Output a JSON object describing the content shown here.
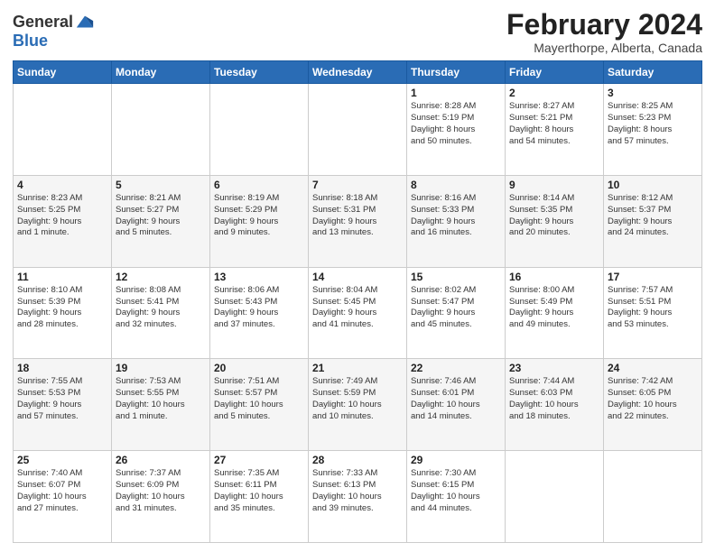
{
  "header": {
    "logo_line1": "General",
    "logo_line2": "Blue",
    "main_title": "February 2024",
    "subtitle": "Mayerthorpe, Alberta, Canada"
  },
  "calendar": {
    "headers": [
      "Sunday",
      "Monday",
      "Tuesday",
      "Wednesday",
      "Thursday",
      "Friday",
      "Saturday"
    ],
    "weeks": [
      [
        {
          "day": "",
          "info": ""
        },
        {
          "day": "",
          "info": ""
        },
        {
          "day": "",
          "info": ""
        },
        {
          "day": "",
          "info": ""
        },
        {
          "day": "1",
          "info": "Sunrise: 8:28 AM\nSunset: 5:19 PM\nDaylight: 8 hours\nand 50 minutes."
        },
        {
          "day": "2",
          "info": "Sunrise: 8:27 AM\nSunset: 5:21 PM\nDaylight: 8 hours\nand 54 minutes."
        },
        {
          "day": "3",
          "info": "Sunrise: 8:25 AM\nSunset: 5:23 PM\nDaylight: 8 hours\nand 57 minutes."
        }
      ],
      [
        {
          "day": "4",
          "info": "Sunrise: 8:23 AM\nSunset: 5:25 PM\nDaylight: 9 hours\nand 1 minute."
        },
        {
          "day": "5",
          "info": "Sunrise: 8:21 AM\nSunset: 5:27 PM\nDaylight: 9 hours\nand 5 minutes."
        },
        {
          "day": "6",
          "info": "Sunrise: 8:19 AM\nSunset: 5:29 PM\nDaylight: 9 hours\nand 9 minutes."
        },
        {
          "day": "7",
          "info": "Sunrise: 8:18 AM\nSunset: 5:31 PM\nDaylight: 9 hours\nand 13 minutes."
        },
        {
          "day": "8",
          "info": "Sunrise: 8:16 AM\nSunset: 5:33 PM\nDaylight: 9 hours\nand 16 minutes."
        },
        {
          "day": "9",
          "info": "Sunrise: 8:14 AM\nSunset: 5:35 PM\nDaylight: 9 hours\nand 20 minutes."
        },
        {
          "day": "10",
          "info": "Sunrise: 8:12 AM\nSunset: 5:37 PM\nDaylight: 9 hours\nand 24 minutes."
        }
      ],
      [
        {
          "day": "11",
          "info": "Sunrise: 8:10 AM\nSunset: 5:39 PM\nDaylight: 9 hours\nand 28 minutes."
        },
        {
          "day": "12",
          "info": "Sunrise: 8:08 AM\nSunset: 5:41 PM\nDaylight: 9 hours\nand 32 minutes."
        },
        {
          "day": "13",
          "info": "Sunrise: 8:06 AM\nSunset: 5:43 PM\nDaylight: 9 hours\nand 37 minutes."
        },
        {
          "day": "14",
          "info": "Sunrise: 8:04 AM\nSunset: 5:45 PM\nDaylight: 9 hours\nand 41 minutes."
        },
        {
          "day": "15",
          "info": "Sunrise: 8:02 AM\nSunset: 5:47 PM\nDaylight: 9 hours\nand 45 minutes."
        },
        {
          "day": "16",
          "info": "Sunrise: 8:00 AM\nSunset: 5:49 PM\nDaylight: 9 hours\nand 49 minutes."
        },
        {
          "day": "17",
          "info": "Sunrise: 7:57 AM\nSunset: 5:51 PM\nDaylight: 9 hours\nand 53 minutes."
        }
      ],
      [
        {
          "day": "18",
          "info": "Sunrise: 7:55 AM\nSunset: 5:53 PM\nDaylight: 9 hours\nand 57 minutes."
        },
        {
          "day": "19",
          "info": "Sunrise: 7:53 AM\nSunset: 5:55 PM\nDaylight: 10 hours\nand 1 minute."
        },
        {
          "day": "20",
          "info": "Sunrise: 7:51 AM\nSunset: 5:57 PM\nDaylight: 10 hours\nand 5 minutes."
        },
        {
          "day": "21",
          "info": "Sunrise: 7:49 AM\nSunset: 5:59 PM\nDaylight: 10 hours\nand 10 minutes."
        },
        {
          "day": "22",
          "info": "Sunrise: 7:46 AM\nSunset: 6:01 PM\nDaylight: 10 hours\nand 14 minutes."
        },
        {
          "day": "23",
          "info": "Sunrise: 7:44 AM\nSunset: 6:03 PM\nDaylight: 10 hours\nand 18 minutes."
        },
        {
          "day": "24",
          "info": "Sunrise: 7:42 AM\nSunset: 6:05 PM\nDaylight: 10 hours\nand 22 minutes."
        }
      ],
      [
        {
          "day": "25",
          "info": "Sunrise: 7:40 AM\nSunset: 6:07 PM\nDaylight: 10 hours\nand 27 minutes."
        },
        {
          "day": "26",
          "info": "Sunrise: 7:37 AM\nSunset: 6:09 PM\nDaylight: 10 hours\nand 31 minutes."
        },
        {
          "day": "27",
          "info": "Sunrise: 7:35 AM\nSunset: 6:11 PM\nDaylight: 10 hours\nand 35 minutes."
        },
        {
          "day": "28",
          "info": "Sunrise: 7:33 AM\nSunset: 6:13 PM\nDaylight: 10 hours\nand 39 minutes."
        },
        {
          "day": "29",
          "info": "Sunrise: 7:30 AM\nSunset: 6:15 PM\nDaylight: 10 hours\nand 44 minutes."
        },
        {
          "day": "",
          "info": ""
        },
        {
          "day": "",
          "info": ""
        }
      ]
    ]
  }
}
